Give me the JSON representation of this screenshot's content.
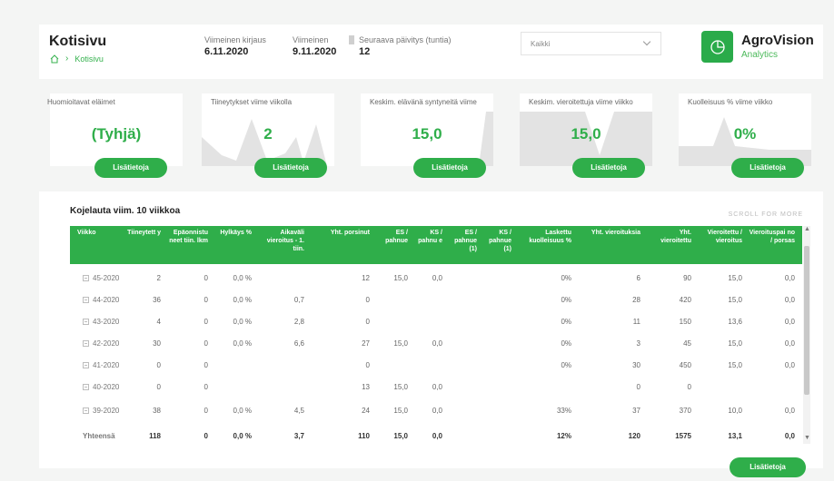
{
  "header": {
    "title": "Kotisivu",
    "breadcrumb": "Kotisivu",
    "last_entry_label": "Viimeinen kirjaus",
    "last_entry_value": "6.11.2020",
    "last_label": "Viimeinen",
    "last_value": "9.11.2020",
    "next_label": "Seuraava päivitys (tuntia)",
    "next_value": "12",
    "filter_selected": "Kaikki"
  },
  "brand": {
    "name": "AgroVision",
    "sub": "Analytics",
    "color": "#2aab4a"
  },
  "kpis": [
    {
      "label": "Huomioitavat eläimet",
      "value": "(Tyhjä)",
      "button": "Lisätietoja"
    },
    {
      "label": "Tiineytykset viime viikolla",
      "value": "2",
      "button": "Lisätietoja"
    },
    {
      "label": "Keskim. elävänä syntyneitä viime",
      "value": "15,0",
      "button": "Lisätietoja"
    },
    {
      "label": "Keskim. vieroitettuja viime viikko",
      "value": "15,0",
      "button": "Lisätietoja"
    },
    {
      "label": "Kuolleisuus % viime viikko",
      "value": "0%",
      "button": "Lisätietoja"
    }
  ],
  "table": {
    "title": "Kojelauta viim. 10 viikkoa",
    "scroll_hint": "SCROLL FOR MORE",
    "headers": [
      "Viikko",
      "Tiineytett y",
      "Epäonnistu neet tiin. lkm",
      "Hylkäys %",
      "Aikaväli vieroitus - 1. tiin.",
      "Yht. porsinut",
      "ES / pahnue",
      "KS / pahnu e",
      "ES / pahnue (1)",
      "KS / pahnue (1)",
      "Laskettu kuolleisuus %",
      "Yht. vieroituksia",
      "Yht. vieroitettu",
      "Vieroitettu / vieroitus",
      "Vieroituspai no / porsas"
    ],
    "rows": [
      [
        "45-2020",
        "2",
        "0",
        "0,0 %",
        "",
        "12",
        "15,0",
        "0,0",
        "",
        "",
        "0%",
        "6",
        "90",
        "15,0",
        "0,0"
      ],
      [
        "44-2020",
        "36",
        "0",
        "0,0 %",
        "0,7",
        "0",
        "",
        "",
        "",
        "",
        "0%",
        "28",
        "420",
        "15,0",
        "0,0"
      ],
      [
        "43-2020",
        "4",
        "0",
        "0,0 %",
        "2,8",
        "0",
        "",
        "",
        "",
        "",
        "0%",
        "11",
        "150",
        "13,6",
        "0,0"
      ],
      [
        "42-2020",
        "30",
        "0",
        "0,0 %",
        "6,6",
        "27",
        "15,0",
        "0,0",
        "",
        "",
        "0%",
        "3",
        "45",
        "15,0",
        "0,0"
      ],
      [
        "41-2020",
        "0",
        "0",
        "",
        "",
        "0",
        "",
        "",
        "",
        "",
        "0%",
        "30",
        "450",
        "15,0",
        "0,0"
      ],
      [
        "40-2020",
        "0",
        "0",
        "",
        "",
        "13",
        "15,0",
        "0,0",
        "",
        "",
        "",
        "0",
        "0",
        "",
        ""
      ],
      [
        "39-2020",
        "38",
        "0",
        "0,0 %",
        "4,5",
        "24",
        "15,0",
        "0,0",
        "",
        "",
        "33%",
        "37",
        "370",
        "10,0",
        "0,0"
      ]
    ],
    "total": [
      "Yhteensä",
      "118",
      "0",
      "0,0 %",
      "3,7",
      "110",
      "15,0",
      "0,0",
      "",
      "",
      "12%",
      "120",
      "1575",
      "13,1",
      "0,0"
    ]
  },
  "bottom_button": "Lisätietoja",
  "accent": "#2fae4a"
}
